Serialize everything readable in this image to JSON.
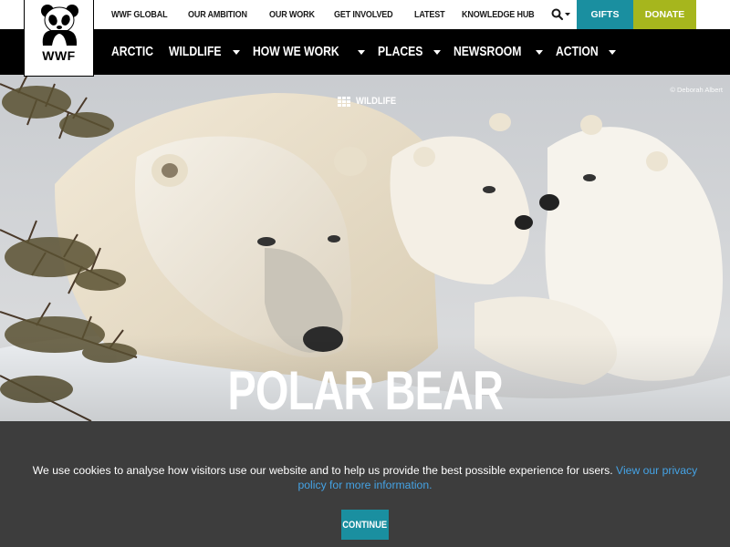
{
  "logo": {
    "text": "WWF",
    "icon": "panda-icon"
  },
  "topbar": {
    "links": [
      "WWF GLOBAL",
      "OUR AMBITION",
      "OUR WORK",
      "GET INVOLVED",
      "LATEST",
      "KNOWLEDGE HUB"
    ],
    "search_icon": "search-icon",
    "gifts_label": "GIFTS",
    "donate_label": "DONATE"
  },
  "mainnav": {
    "items": [
      {
        "label": "ARCTIC",
        "dropdown": false
      },
      {
        "label": "WILDLIFE",
        "dropdown": true
      },
      {
        "label": "HOW WE WORK",
        "dropdown": true
      },
      {
        "label": "PLACES",
        "dropdown": true
      },
      {
        "label": "NEWSROOM",
        "dropdown": true
      },
      {
        "label": "ACTION",
        "dropdown": true
      }
    ]
  },
  "hero": {
    "credit": "© Deborah Albert",
    "breadcrumb": "WILDLIFE",
    "title": "POLAR BEAR"
  },
  "cookie": {
    "text": "We use cookies to analyse how visitors use our website and to help us provide the best possible experience for users.",
    "link_text": "View our privacy policy for more information.",
    "button_label": "CONTINUE"
  },
  "colors": {
    "gifts": "#1a8fa0",
    "donate": "#a6b61d",
    "nav_bg": "#000000",
    "cookie_bg": "#3d3d3d",
    "link": "#45a3e5"
  }
}
